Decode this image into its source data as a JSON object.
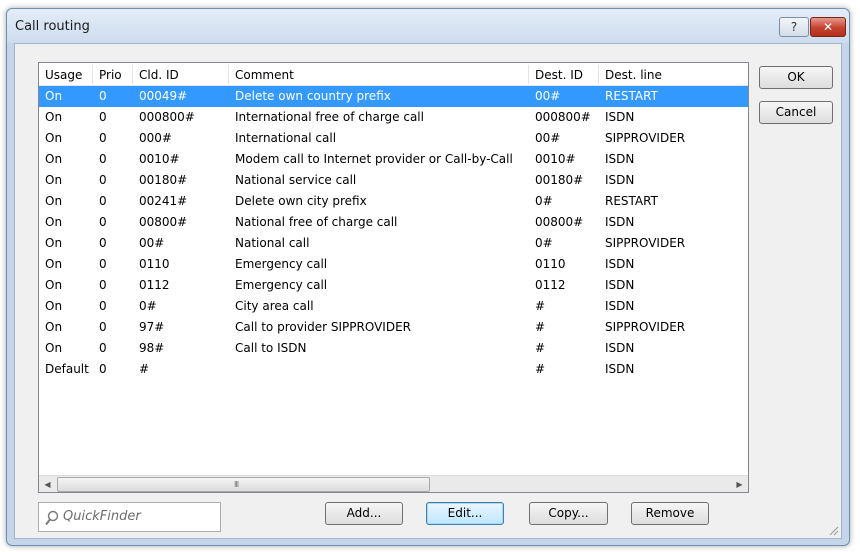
{
  "window": {
    "title": "Call routing",
    "help_label": "?",
    "close_label": "✕"
  },
  "table": {
    "columns": [
      "Usage",
      "Prio",
      "Cld. ID",
      "Comment",
      "Dest. ID",
      "Dest. line"
    ],
    "rows": [
      [
        "On",
        "0",
        "00049#",
        "Delete own country prefix",
        "00#",
        "RESTART"
      ],
      [
        "On",
        "0",
        "000800#",
        "International free of charge call",
        "000800#",
        "ISDN"
      ],
      [
        "On",
        "0",
        "000#",
        "International call",
        "00#",
        "SIPPROVIDER"
      ],
      [
        "On",
        "0",
        "0010#",
        "Modem call to Internet provider or Call-by-Call",
        "0010#",
        "ISDN"
      ],
      [
        "On",
        "0",
        "00180#",
        "National service call",
        "00180#",
        "ISDN"
      ],
      [
        "On",
        "0",
        "00241#",
        "Delete own city prefix",
        "0#",
        "RESTART"
      ],
      [
        "On",
        "0",
        "00800#",
        "National free of charge call",
        "00800#",
        "ISDN"
      ],
      [
        "On",
        "0",
        "00#",
        "National call",
        "0#",
        "SIPPROVIDER"
      ],
      [
        "On",
        "0",
        "0110",
        "Emergency call",
        "0110",
        "ISDN"
      ],
      [
        "On",
        "0",
        "0112",
        "Emergency call",
        "0112",
        "ISDN"
      ],
      [
        "On",
        "0",
        "0#",
        "City area call",
        "#",
        "ISDN"
      ],
      [
        "On",
        "0",
        "97#",
        "Call to provider SIPPROVIDER",
        "#",
        "SIPPROVIDER"
      ],
      [
        "On",
        "0",
        "98#",
        "Call to ISDN",
        "#",
        "ISDN"
      ],
      [
        "Default",
        "0",
        "#",
        "",
        "#",
        "ISDN"
      ]
    ],
    "selected_row": 0,
    "scroll_left_arrow": "◀",
    "scroll_right_arrow": "▶",
    "scroll_grip": "III"
  },
  "buttons": {
    "ok": "OK",
    "cancel": "Cancel",
    "add": "Add...",
    "edit": "Edit...",
    "copy": "Copy...",
    "remove": "Remove"
  },
  "quickfinder": {
    "placeholder": "QuickFinder",
    "icon": "search-icon"
  },
  "colors": {
    "selection": "#3399ff",
    "close_button": "#c4412e"
  }
}
